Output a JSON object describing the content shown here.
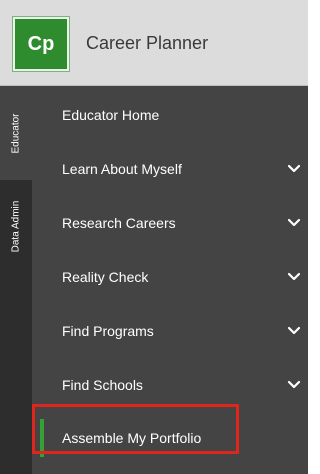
{
  "app": {
    "logo_text": "Cp",
    "title": "Career Planner",
    "brand_color": "#2e8b2e"
  },
  "vtabs": [
    {
      "label": "Educator",
      "active": true
    },
    {
      "label": "Data Admin",
      "active": false
    }
  ],
  "menu": {
    "items": [
      {
        "label": "Educator Home",
        "has_submenu": false
      },
      {
        "label": "Learn About Myself",
        "has_submenu": true
      },
      {
        "label": "Research Careers",
        "has_submenu": true
      },
      {
        "label": "Reality Check",
        "has_submenu": true
      },
      {
        "label": "Find Programs",
        "has_submenu": true
      },
      {
        "label": "Find Schools",
        "has_submenu": true
      },
      {
        "label": "Assemble My Portfolio",
        "has_submenu": false,
        "active": true
      }
    ],
    "icons": {
      "submenu": "chevron-down-icon"
    },
    "colors": {
      "active_indicator": "#35a035",
      "highlight": "#e0251d"
    }
  }
}
